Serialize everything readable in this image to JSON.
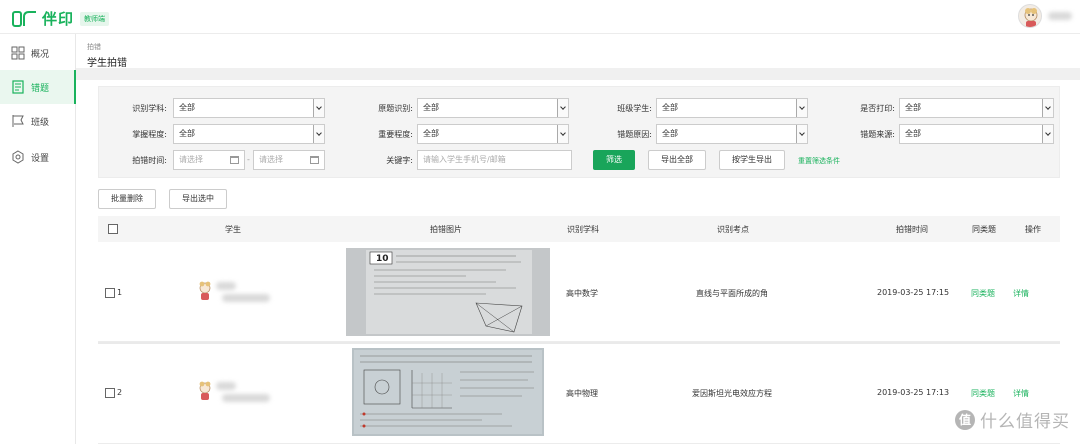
{
  "header": {
    "app_name": "伴印",
    "role_badge": "教师端"
  },
  "sidebar": {
    "items": [
      {
        "label": "概况",
        "icon": "grid-icon"
      },
      {
        "label": "错题",
        "icon": "document-icon"
      },
      {
        "label": "班级",
        "icon": "flag-icon"
      },
      {
        "label": "设置",
        "icon": "gear-icon"
      }
    ],
    "active": "错题"
  },
  "breadcrumb": "拍错",
  "page_title": "学生拍错",
  "filters": {
    "subject_label": "识别学科:",
    "subject_value": "全部",
    "origin_label": "原题识别:",
    "origin_value": "全部",
    "class_label": "班级学生:",
    "class_value": "全部",
    "printed_label": "是否打印:",
    "printed_value": "全部",
    "mastery_label": "掌握程度:",
    "mastery_value": "全部",
    "importance_label": "重要程度:",
    "importance_value": "全部",
    "reason_label": "错题原因:",
    "reason_value": "全部",
    "source_label": "错题来源:",
    "source_value": "全部",
    "time_label": "拍错时间:",
    "date_placeholder": "请选择",
    "date_sep": "-",
    "keyword_label": "关键字:",
    "keyword_placeholder": "请输入学生手机号/邮箱",
    "filter_btn": "筛选",
    "export_all_btn": "导出全部",
    "export_by_student_btn": "按学生导出",
    "reset_link": "重置筛选条件"
  },
  "actions": {
    "batch_delete": "批量删除",
    "export_selected": "导出选中"
  },
  "table": {
    "columns": [
      "学生",
      "拍错图片",
      "识别学科",
      "识别考点",
      "拍错时间",
      "同类题",
      "操作"
    ],
    "rows": [
      {
        "index": "1",
        "subject": "高中数学",
        "topic": "直线与平面所成的角",
        "time": "2019-03-25 17:15",
        "similar": "同类题",
        "action": "详情"
      },
      {
        "index": "2",
        "subject": "高中物理",
        "topic": "爱因斯坦光电效应方程",
        "time": "2019-03-25 17:13",
        "similar": "同类题",
        "action": "详情"
      }
    ]
  },
  "watermark": {
    "symbol": "值",
    "text": "什么值得买"
  },
  "colors": {
    "brand_green": "#19b25c",
    "button_green": "#19a55a"
  }
}
